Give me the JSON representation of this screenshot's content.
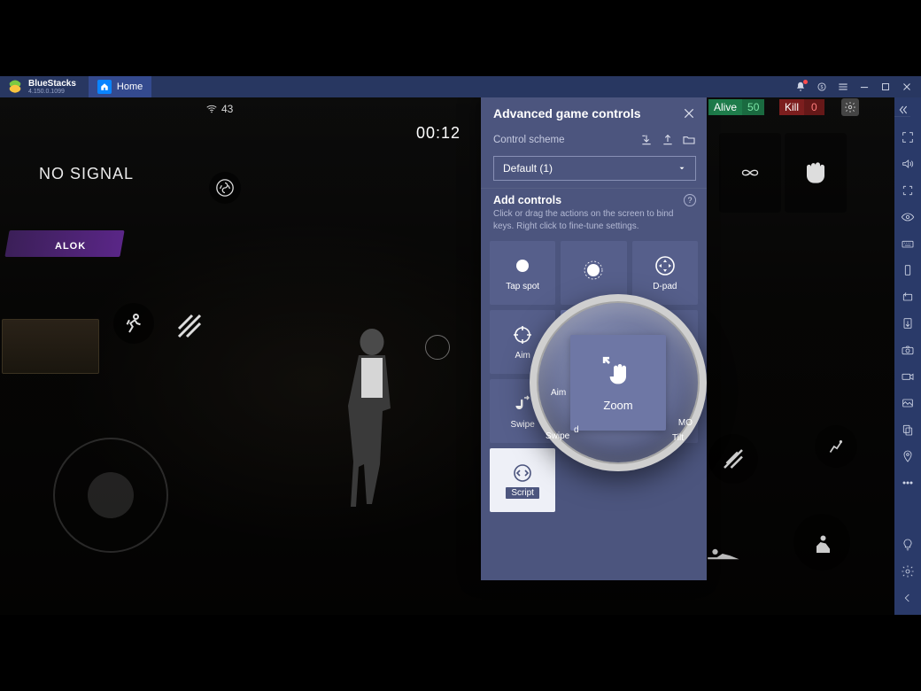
{
  "titlebar": {
    "brand": "BlueStacks",
    "version": "4.150.0.1099",
    "home_tab": "Home"
  },
  "hud": {
    "wifi": "43",
    "timer": "00:12",
    "nosignal": "NO SIGNAL",
    "alive_label": "Alive",
    "alive_value": "50",
    "kill_label": "Kill",
    "kill_value": "0",
    "alok": "ALOK"
  },
  "panel": {
    "title": "Advanced game controls",
    "scheme_label": "Control scheme",
    "scheme_value": "Default (1)",
    "add_title": "Add controls",
    "hint": "Click or drag the actions on the screen to bind keys. Right click to fine-tune settings.",
    "tiles": {
      "tap": "Tap spot",
      "repeat": "",
      "dpad": "D-pad",
      "aim": "Aim",
      "zoom": "Zoom",
      "moba": "MOBA",
      "swipe": "Swipe",
      "state": "",
      "tilt": "Tilt",
      "script": "Script"
    },
    "magnified_label": "Zoom"
  },
  "peek": {
    "aim": "Aim",
    "swipe": "Swipe",
    "tilt": "Tilt",
    "moba": "MO",
    "d": "d"
  }
}
